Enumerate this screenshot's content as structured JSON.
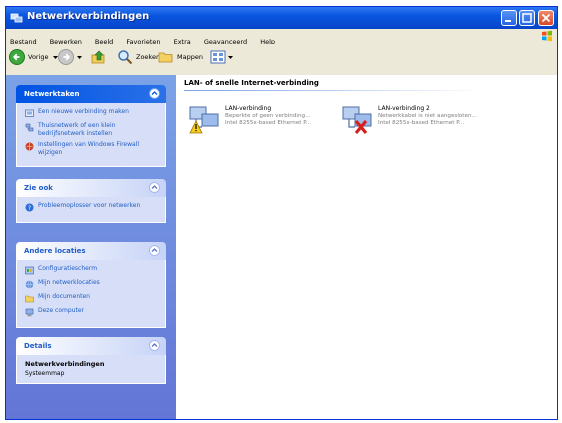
{
  "window": {
    "title": "Netwerkverbindingen"
  },
  "menu": [
    "Bestand",
    "Bewerken",
    "Beeld",
    "Favorieten",
    "Extra",
    "Geavanceerd",
    "Help"
  ],
  "toolbar": {
    "back": "Vorige",
    "search": "Zoeken",
    "folders": "Mappen"
  },
  "sidebar": {
    "network_tasks": {
      "title": "Netwerktaken",
      "items": [
        "Een nieuwe verbinding maken",
        "Thuisnetwerk of een klein bedrijfsnetwerk instellen",
        "Instellingen van Windows Firewall wijzigen"
      ]
    },
    "see_also": {
      "title": "Zie ook",
      "items": [
        "Probleemoplosser voor netwerken"
      ]
    },
    "other_places": {
      "title": "Andere locaties",
      "items": [
        "Configuratiescherm",
        "Mijn netwerklocaties",
        "Mijn documenten",
        "Deze computer"
      ]
    },
    "details": {
      "title": "Details",
      "name": "Netwerkverbindingen",
      "type": "Systeemmap"
    }
  },
  "content": {
    "section_title": "LAN- of snelle Internet-verbinding",
    "connections": [
      {
        "name": "LAN-verbinding",
        "status": "Beperkte of geen verbinding...",
        "device": "Intel 8255x-based Ethernet P..."
      },
      {
        "name": "LAN-verbinding 2",
        "status": "Netwerkkabel is niet aangesloten...",
        "device": "Intel 8255x-based Ethernet P..."
      }
    ]
  },
  "colors": {
    "titlebar": "#0a55e0",
    "sidebar": "#6f8de0",
    "link": "#215dc6",
    "close": "#d54a25"
  },
  "icons": {
    "title": "network-connections-icon",
    "back": "back-arrow-icon",
    "forward": "forward-arrow-icon",
    "up": "folder-up-icon",
    "search": "search-icon",
    "folders": "folders-icon",
    "views": "views-icon"
  }
}
